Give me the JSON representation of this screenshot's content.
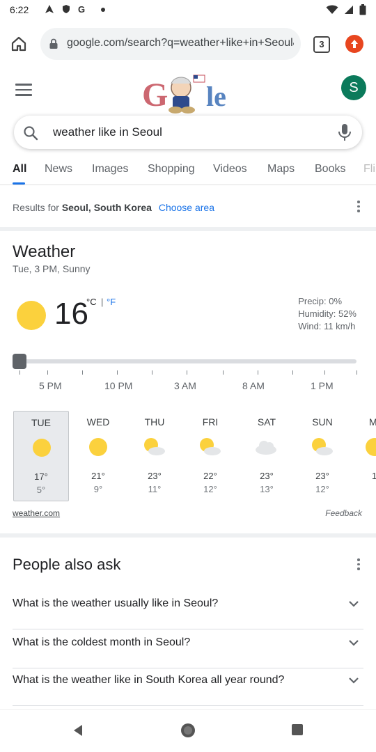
{
  "status_bar": {
    "time": "6:22"
  },
  "browser": {
    "url": "google.com/search?q=weather+like+in+Seoul&oq=w",
    "tab_count": "3"
  },
  "google": {
    "avatar_letter": "S",
    "search_query": "weather like in Seoul"
  },
  "tabs": [
    {
      "label": "All"
    },
    {
      "label": "News"
    },
    {
      "label": "Images"
    },
    {
      "label": "Shopping"
    },
    {
      "label": "Videos"
    },
    {
      "label": "Maps"
    },
    {
      "label": "Books"
    },
    {
      "label": "Fli"
    }
  ],
  "results_for": {
    "prefix": "Results for",
    "location": "Seoul, South Korea",
    "link": "Choose area"
  },
  "weather": {
    "title": "Weather",
    "subtitle": "Tue, 3 PM, Sunny",
    "temperature": "16",
    "unit_c": "°C",
    "unit_sep": "|",
    "unit_f": "°F",
    "precip": "Precip: 0%",
    "humidity": "Humidity: 52%",
    "wind": "Wind: 11 km/h",
    "time_labels": [
      "5 PM",
      "10 PM",
      "3 AM",
      "8 AM",
      "1 PM"
    ],
    "days": [
      {
        "name": "TUE",
        "icon": "sun-icon",
        "hi": "17°",
        "lo": "5°"
      },
      {
        "name": "WED",
        "icon": "sun-icon",
        "hi": "21°",
        "lo": "9°"
      },
      {
        "name": "THU",
        "icon": "partly-cloudy-icon",
        "hi": "23°",
        "lo": "11°"
      },
      {
        "name": "FRI",
        "icon": "partly-cloudy-icon",
        "hi": "22°",
        "lo": "12°"
      },
      {
        "name": "SAT",
        "icon": "cloud-icon",
        "hi": "23°",
        "lo": "13°"
      },
      {
        "name": "SUN",
        "icon": "partly-cloudy-icon",
        "hi": "23°",
        "lo": "12°"
      },
      {
        "name": "M",
        "icon": "sun-icon",
        "hi": "1",
        "lo": ""
      }
    ],
    "source": "weather.com",
    "feedback": "Feedback"
  },
  "people_also_ask": {
    "title": "People also ask",
    "questions": [
      "What is the weather usually like in Seoul?",
      "What is the coldest month in Seoul?",
      "What is the weather like in South Korea all year round?"
    ]
  },
  "colors": {
    "accent": "#1a73e8",
    "sun": "#fbd13d",
    "avatar": "#0b7a5b",
    "update_badge": "#e8461f"
  }
}
